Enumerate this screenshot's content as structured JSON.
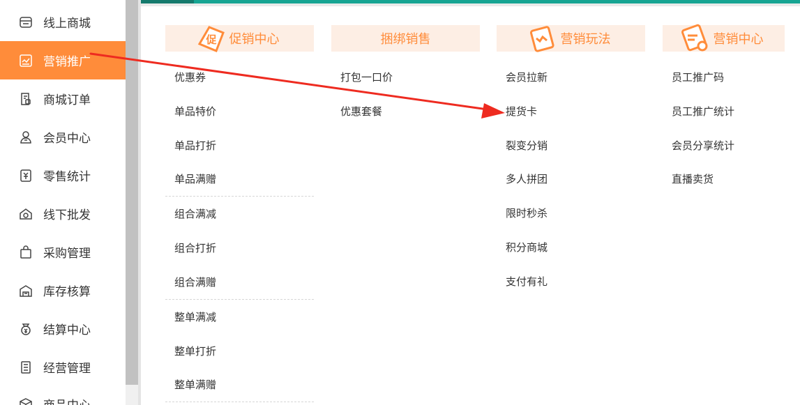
{
  "sidebar": {
    "items": [
      {
        "label": "线上商城",
        "icon": "store-icon",
        "active": false
      },
      {
        "label": "营销推广",
        "icon": "promotion-chart-icon",
        "active": true
      },
      {
        "label": "商城订单",
        "icon": "order-icon",
        "active": false
      },
      {
        "label": "会员中心",
        "icon": "member-icon",
        "active": false
      },
      {
        "label": "零售统计",
        "icon": "retail-stats-icon",
        "active": false
      },
      {
        "label": "线下批发",
        "icon": "wholesale-icon",
        "active": false
      },
      {
        "label": "采购管理",
        "icon": "purchase-bag-icon",
        "active": false
      },
      {
        "label": "库存核算",
        "icon": "warehouse-icon",
        "active": false
      },
      {
        "label": "结算中心",
        "icon": "settlement-icon",
        "active": false
      },
      {
        "label": "经营管理",
        "icon": "management-icon",
        "active": false
      },
      {
        "label": "商品中心",
        "icon": "goods-icon",
        "active": false
      }
    ]
  },
  "columns": [
    {
      "title": "促销中心",
      "icon": "promo-tag-icon",
      "items": [
        "优惠券",
        "单品特价",
        "单品打折",
        "单品满赠",
        "组合满减",
        "组合打折",
        "组合满赠",
        "整单满减",
        "整单打折",
        "整单满赠"
      ]
    },
    {
      "title": "捆绑销售",
      "icon": "",
      "items": [
        "打包一口价",
        "优惠套餐"
      ]
    },
    {
      "title": "营销玩法",
      "icon": "marketing-play-icon",
      "items": [
        "会员拉新",
        "提货卡",
        "裂变分销",
        "多人拼团",
        "限时秒杀",
        "积分商城",
        "支付有礼"
      ]
    },
    {
      "title": "营销中心",
      "icon": "marketing-center-icon",
      "items": [
        "员工推广码",
        "员工推广统计",
        "会员分享统计",
        "直播卖货"
      ]
    }
  ],
  "colors": {
    "accent": "#ff8c3a",
    "header_bg": "#fdeee4",
    "top_bar": "#17a593",
    "arrow": "#ee2b20"
  },
  "annotation": {
    "type": "arrow",
    "from": "营销推广",
    "to": "提货卡"
  }
}
